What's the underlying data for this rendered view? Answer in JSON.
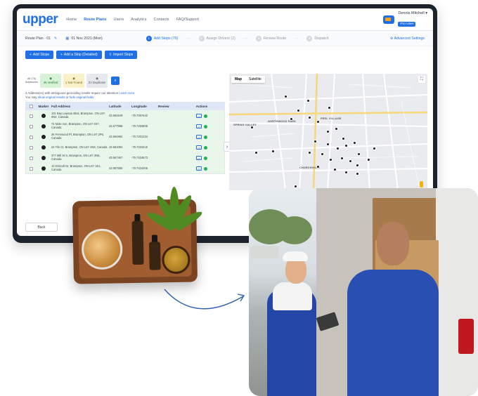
{
  "app": {
    "logo": "upper",
    "logo_sub": "ROUTE PLANNER",
    "nav": [
      "Home",
      "Route Plans",
      "Users",
      "Analytics",
      "Contacts",
      "FAQ/Support"
    ],
    "active_nav": "Route Plans",
    "user_name": "Dennis Mitchell",
    "user_badge": "Pro User"
  },
  "subheader": {
    "route_name": "Route Plan - 01",
    "date": "01 Nov 2021 (Mon)",
    "steps": [
      {
        "num": "1",
        "label": "Add Stops (75)"
      },
      {
        "num": "2",
        "label": "Assign Drivers (2)"
      },
      {
        "num": "3",
        "label": "Review Route"
      },
      {
        "num": "4",
        "label": "Dispatch"
      }
    ],
    "advanced_settings": "Advanced Settings"
  },
  "toolbar": {
    "add_stops": "Add Stops",
    "add_stop_detailed": "Add a Stop (Detailed)",
    "import_stops": "Import Stops"
  },
  "counts": {
    "all_label": "All (75) Addresses",
    "verified": "46 Verified",
    "not_found": "1 Not Found",
    "duplicate": "22 Duplicate"
  },
  "warning": {
    "line1": "3 Address(es) with ambiguous geocoding results require our attention",
    "learn_more": "Learn more",
    "line2": "You may",
    "link2": "show original results",
    "or": "or",
    "link3": "hide original fields"
  },
  "table": {
    "headers": [
      "Marker",
      "Full Address",
      "Latitude",
      "Longitude",
      "Review",
      "Actions"
    ],
    "rows": [
      {
        "address": "101 Bay Lawson Blvd, Brampton, ON L6Y 0N2, Canada",
        "lat": "43.692649",
        "lon": "-79.7067642"
      },
      {
        "address": "74 Mole Ave, Brampton, ON L6Y 4S7, Canada",
        "lat": "43.677998",
        "lon": "-79.7293806"
      },
      {
        "address": "26 Fernwood Pl, Brampton, ON L6Y 2P6, Canada",
        "lat": "43.654884",
        "lon": "-79.7201234"
      },
      {
        "address": "24 Tiln Ct, Brampton, ON L6Y 4N6, Canada",
        "lat": "43.661084",
        "lon": "-79.7323415"
      },
      {
        "address": "377 Mill St S, Brampton, ON L6Y 3N6, Canada",
        "lat": "43.667467",
        "lon": "-79.7418573"
      },
      {
        "address": "13 Driscoll Dr, Brampton, ON L6Y 1E1, Canada",
        "lat": "43.687555",
        "lon": "-79.7416206"
      }
    ]
  },
  "back_button": "Back",
  "map": {
    "tab_map": "Map",
    "tab_satellite": "Satellite",
    "labels": [
      "NORTHWOOD PARK",
      "PEEL VILLAGE",
      "SPRING VALLEY",
      "CHURCHVILLE"
    ]
  },
  "colors": {
    "brand_blue": "#1f6fe6",
    "verified_green": "#d8f2d8",
    "not_found_yellow": "#fbf1c9",
    "ok_green": "#22b14c"
  }
}
